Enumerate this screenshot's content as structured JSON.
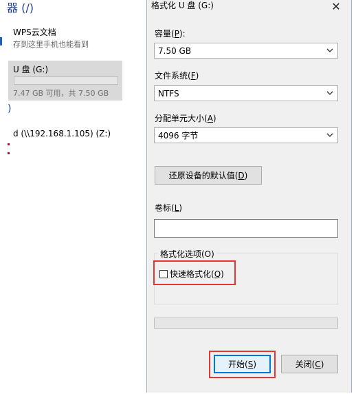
{
  "background": {
    "heading": "器 (/)",
    "wps_title": "WPS云文档",
    "wps_subtitle": "存到这里手机也能看到",
    "drive_name": "U 盘 (G:)",
    "drive_usage": "7.47 GB 可用，共 7.50 GB",
    "paren": ")",
    "network_drive": "d (\\\\192.168.1.105) (Z:)"
  },
  "dialog": {
    "title": "格式化 U 盘 (G:)",
    "close_glyph": "✕",
    "capacity": {
      "label": "容量(",
      "key": "P",
      "label_end": "):",
      "value": "7.50 GB"
    },
    "filesystem": {
      "label": "文件系统(",
      "key": "F",
      "label_end": ")",
      "value": "NTFS"
    },
    "alloc": {
      "label": "分配单元大小(",
      "key": "A",
      "label_end": ")",
      "value": "4096 字节"
    },
    "restore_defaults": {
      "label": "还原设备的默认值(",
      "key": "D",
      "label_end": ")"
    },
    "volume_label": {
      "label": "卷标(",
      "key": "L",
      "label_end": ")",
      "value": ""
    },
    "format_options": {
      "label": "格式化选项(O)"
    },
    "quick_format": {
      "label": "快速格式化(",
      "key": "Q",
      "label_end": ")",
      "checked": false
    },
    "progress": 0,
    "start_button": {
      "label": "开始(",
      "key": "S",
      "label_end": ")"
    },
    "close_button": {
      "label": "关闭(",
      "key": "C",
      "label_end": ")"
    },
    "highlight_color": "#e53535"
  }
}
